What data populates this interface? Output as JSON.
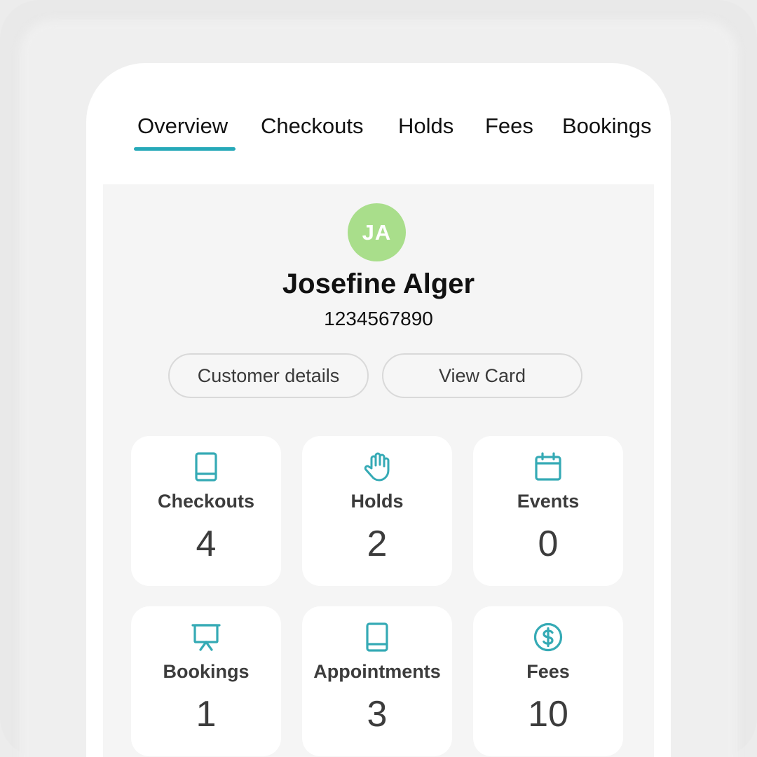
{
  "tabs": [
    {
      "label": "Overview",
      "active": true
    },
    {
      "label": "Checkouts",
      "active": false
    },
    {
      "label": "Holds",
      "active": false
    },
    {
      "label": "Fees",
      "active": false
    },
    {
      "label": "Bookings",
      "active": false
    }
  ],
  "colors": {
    "accent": "#26a9b8",
    "avatar": "#a9de8b",
    "icon": "#35aab5"
  },
  "profile": {
    "initials": "JA",
    "name": "Josefine Alger",
    "card_number": "1234567890"
  },
  "actions": {
    "customer_details": "Customer details",
    "view_card": "View Card"
  },
  "tiles": [
    {
      "label": "Checkouts",
      "count": "4",
      "icon": "book-icon"
    },
    {
      "label": "Holds",
      "count": "2",
      "icon": "hand-icon"
    },
    {
      "label": "Events",
      "count": "0",
      "icon": "calendar-icon"
    },
    {
      "label": "Bookings",
      "count": "1",
      "icon": "presentation-board-icon"
    },
    {
      "label": "Appointments",
      "count": "3",
      "icon": "book-icon"
    },
    {
      "label": "Fees",
      "count": "10",
      "icon": "dollar-circle-icon"
    }
  ]
}
